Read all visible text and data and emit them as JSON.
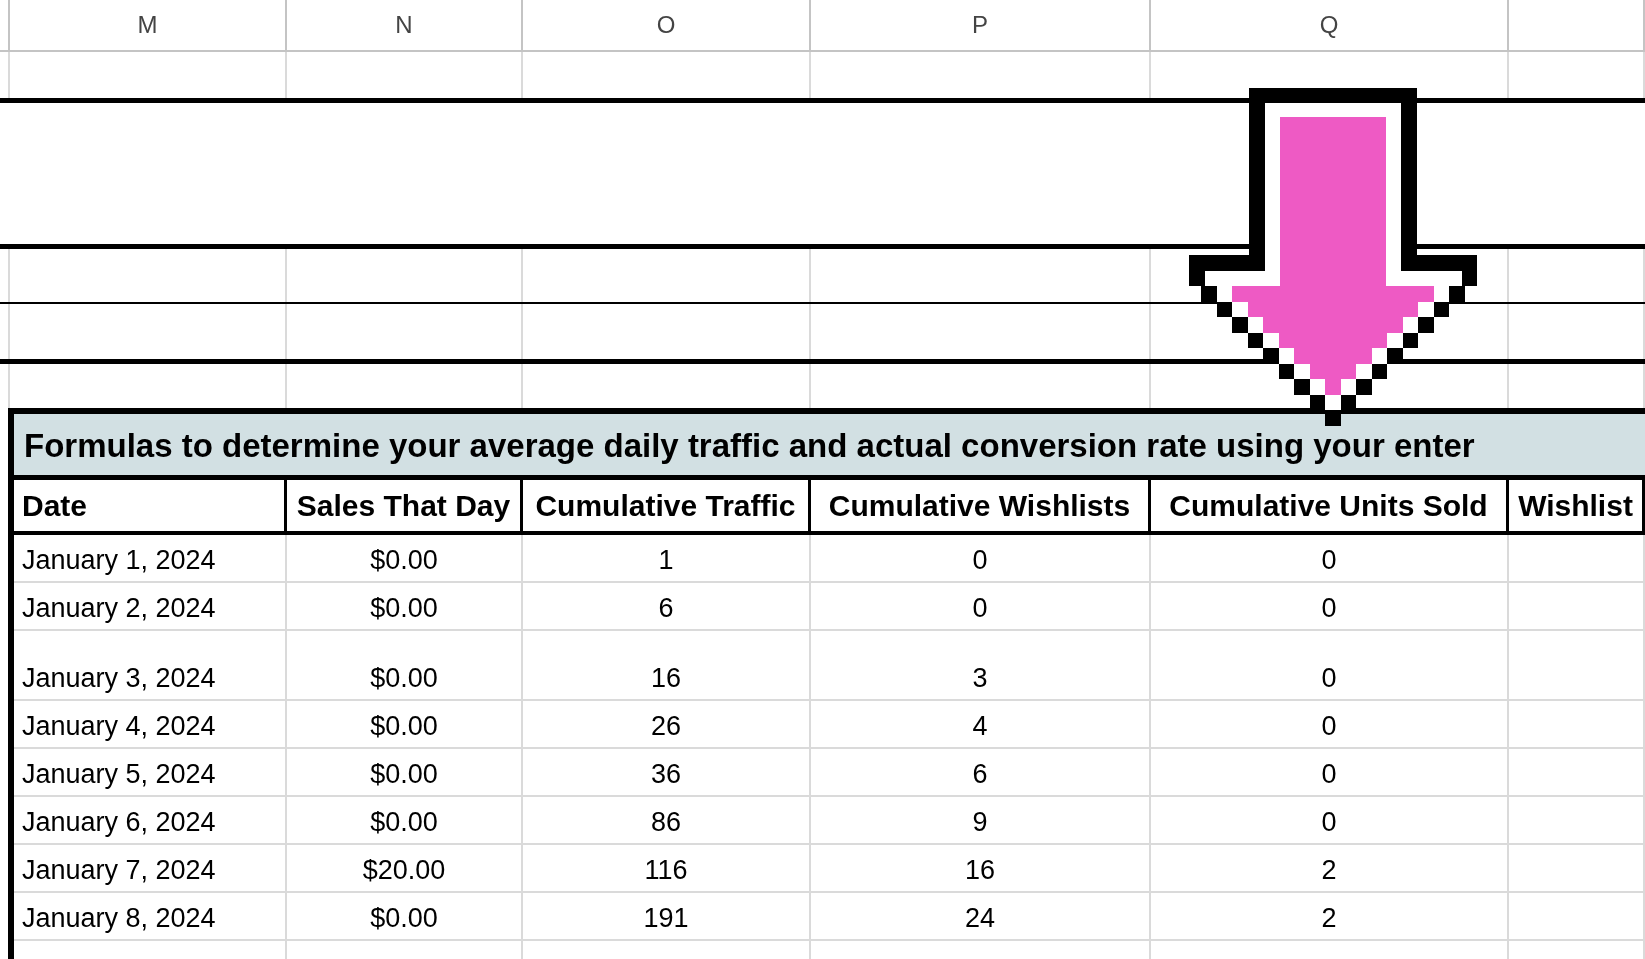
{
  "column_headers": [
    "M",
    "N",
    "O",
    "P",
    "Q"
  ],
  "table": {
    "title": "Formulas to determine your average daily traffic and actual conversion rate using your enter",
    "columns": [
      "Date",
      "Sales That Day",
      "Cumulative Traffic",
      "Cumulative Wishlists",
      "Cumulative Units Sold",
      "Wishlist"
    ],
    "rows": [
      [
        "January 1, 2024",
        "$0.00",
        "1",
        "0",
        "0"
      ],
      [
        "January 2, 2024",
        "$0.00",
        "6",
        "0",
        "0"
      ],
      [
        "January 3, 2024",
        "$0.00",
        "16",
        "3",
        "0"
      ],
      [
        "January 4, 2024",
        "$0.00",
        "26",
        "4",
        "0"
      ],
      [
        "January 5, 2024",
        "$0.00",
        "36",
        "6",
        "0"
      ],
      [
        "January 6, 2024",
        "$0.00",
        "86",
        "9",
        "0"
      ],
      [
        "January 7, 2024",
        "$20.00",
        "116",
        "16",
        "2"
      ],
      [
        "January 8, 2024",
        "$0.00",
        "191",
        "24",
        "2"
      ]
    ]
  }
}
